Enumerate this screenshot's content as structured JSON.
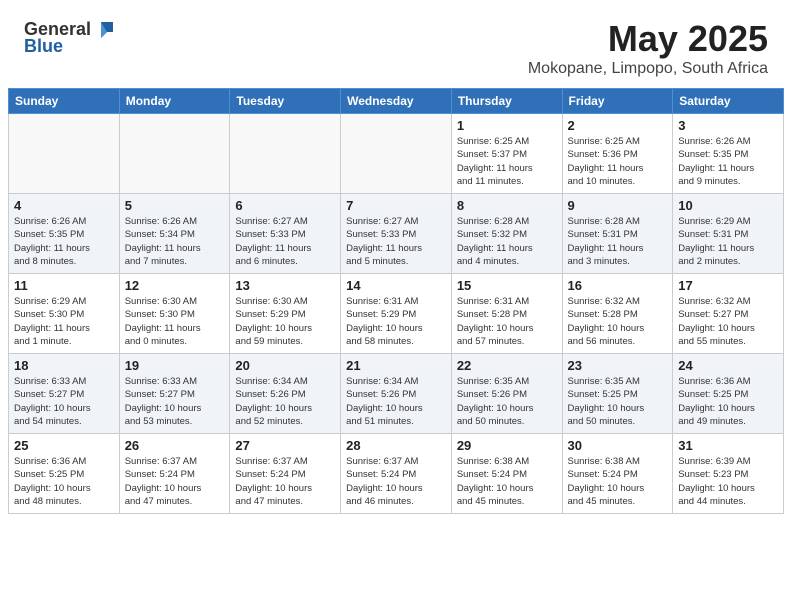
{
  "header": {
    "logo_general": "General",
    "logo_blue": "Blue",
    "title": "May 2025",
    "subtitle": "Mokopane, Limpopo, South Africa"
  },
  "weekdays": [
    "Sunday",
    "Monday",
    "Tuesday",
    "Wednesday",
    "Thursday",
    "Friday",
    "Saturday"
  ],
  "weeks": [
    [
      {
        "day": "",
        "info": ""
      },
      {
        "day": "",
        "info": ""
      },
      {
        "day": "",
        "info": ""
      },
      {
        "day": "",
        "info": ""
      },
      {
        "day": "1",
        "info": "Sunrise: 6:25 AM\nSunset: 5:37 PM\nDaylight: 11 hours\nand 11 minutes."
      },
      {
        "day": "2",
        "info": "Sunrise: 6:25 AM\nSunset: 5:36 PM\nDaylight: 11 hours\nand 10 minutes."
      },
      {
        "day": "3",
        "info": "Sunrise: 6:26 AM\nSunset: 5:35 PM\nDaylight: 11 hours\nand 9 minutes."
      }
    ],
    [
      {
        "day": "4",
        "info": "Sunrise: 6:26 AM\nSunset: 5:35 PM\nDaylight: 11 hours\nand 8 minutes."
      },
      {
        "day": "5",
        "info": "Sunrise: 6:26 AM\nSunset: 5:34 PM\nDaylight: 11 hours\nand 7 minutes."
      },
      {
        "day": "6",
        "info": "Sunrise: 6:27 AM\nSunset: 5:33 PM\nDaylight: 11 hours\nand 6 minutes."
      },
      {
        "day": "7",
        "info": "Sunrise: 6:27 AM\nSunset: 5:33 PM\nDaylight: 11 hours\nand 5 minutes."
      },
      {
        "day": "8",
        "info": "Sunrise: 6:28 AM\nSunset: 5:32 PM\nDaylight: 11 hours\nand 4 minutes."
      },
      {
        "day": "9",
        "info": "Sunrise: 6:28 AM\nSunset: 5:31 PM\nDaylight: 11 hours\nand 3 minutes."
      },
      {
        "day": "10",
        "info": "Sunrise: 6:29 AM\nSunset: 5:31 PM\nDaylight: 11 hours\nand 2 minutes."
      }
    ],
    [
      {
        "day": "11",
        "info": "Sunrise: 6:29 AM\nSunset: 5:30 PM\nDaylight: 11 hours\nand 1 minute."
      },
      {
        "day": "12",
        "info": "Sunrise: 6:30 AM\nSunset: 5:30 PM\nDaylight: 11 hours\nand 0 minutes."
      },
      {
        "day": "13",
        "info": "Sunrise: 6:30 AM\nSunset: 5:29 PM\nDaylight: 10 hours\nand 59 minutes."
      },
      {
        "day": "14",
        "info": "Sunrise: 6:31 AM\nSunset: 5:29 PM\nDaylight: 10 hours\nand 58 minutes."
      },
      {
        "day": "15",
        "info": "Sunrise: 6:31 AM\nSunset: 5:28 PM\nDaylight: 10 hours\nand 57 minutes."
      },
      {
        "day": "16",
        "info": "Sunrise: 6:32 AM\nSunset: 5:28 PM\nDaylight: 10 hours\nand 56 minutes."
      },
      {
        "day": "17",
        "info": "Sunrise: 6:32 AM\nSunset: 5:27 PM\nDaylight: 10 hours\nand 55 minutes."
      }
    ],
    [
      {
        "day": "18",
        "info": "Sunrise: 6:33 AM\nSunset: 5:27 PM\nDaylight: 10 hours\nand 54 minutes."
      },
      {
        "day": "19",
        "info": "Sunrise: 6:33 AM\nSunset: 5:27 PM\nDaylight: 10 hours\nand 53 minutes."
      },
      {
        "day": "20",
        "info": "Sunrise: 6:34 AM\nSunset: 5:26 PM\nDaylight: 10 hours\nand 52 minutes."
      },
      {
        "day": "21",
        "info": "Sunrise: 6:34 AM\nSunset: 5:26 PM\nDaylight: 10 hours\nand 51 minutes."
      },
      {
        "day": "22",
        "info": "Sunrise: 6:35 AM\nSunset: 5:26 PM\nDaylight: 10 hours\nand 50 minutes."
      },
      {
        "day": "23",
        "info": "Sunrise: 6:35 AM\nSunset: 5:25 PM\nDaylight: 10 hours\nand 50 minutes."
      },
      {
        "day": "24",
        "info": "Sunrise: 6:36 AM\nSunset: 5:25 PM\nDaylight: 10 hours\nand 49 minutes."
      }
    ],
    [
      {
        "day": "25",
        "info": "Sunrise: 6:36 AM\nSunset: 5:25 PM\nDaylight: 10 hours\nand 48 minutes."
      },
      {
        "day": "26",
        "info": "Sunrise: 6:37 AM\nSunset: 5:24 PM\nDaylight: 10 hours\nand 47 minutes."
      },
      {
        "day": "27",
        "info": "Sunrise: 6:37 AM\nSunset: 5:24 PM\nDaylight: 10 hours\nand 47 minutes."
      },
      {
        "day": "28",
        "info": "Sunrise: 6:37 AM\nSunset: 5:24 PM\nDaylight: 10 hours\nand 46 minutes."
      },
      {
        "day": "29",
        "info": "Sunrise: 6:38 AM\nSunset: 5:24 PM\nDaylight: 10 hours\nand 45 minutes."
      },
      {
        "day": "30",
        "info": "Sunrise: 6:38 AM\nSunset: 5:24 PM\nDaylight: 10 hours\nand 45 minutes."
      },
      {
        "day": "31",
        "info": "Sunrise: 6:39 AM\nSunset: 5:23 PM\nDaylight: 10 hours\nand 44 minutes."
      }
    ]
  ]
}
